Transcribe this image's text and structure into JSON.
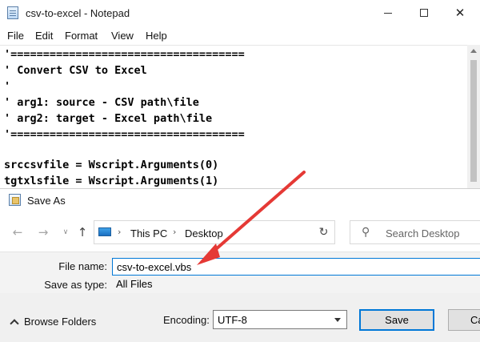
{
  "notepad": {
    "title": "csv-to-excel - Notepad",
    "menu": [
      "File",
      "Edit",
      "Format",
      "View",
      "Help"
    ],
    "code_lines": [
      "'====================================",
      "' Convert CSV to Excel",
      "'",
      "' arg1: source - CSV path\\file",
      "' arg2: target - Excel path\\file",
      "'====================================",
      "",
      "srccsvfile = Wscript.Arguments(0)",
      "tgtxlsfile = Wscript.Arguments(1)"
    ]
  },
  "save_as": {
    "title": "Save As",
    "breadcrumb": [
      "This PC",
      "Desktop"
    ],
    "search_placeholder": "Search Desktop",
    "file_name_label": "File name:",
    "file_name_value": "csv-to-excel.vbs",
    "save_as_type_label": "Save as type:",
    "save_as_type_value": "All Files",
    "browse_folders_label": "Browse Folders",
    "encoding_label": "Encoding:",
    "encoding_value": "UTF-8",
    "save_button": "Save",
    "cancel_button": "Ca"
  },
  "annotation": {
    "arrow_color": "#e53935"
  }
}
